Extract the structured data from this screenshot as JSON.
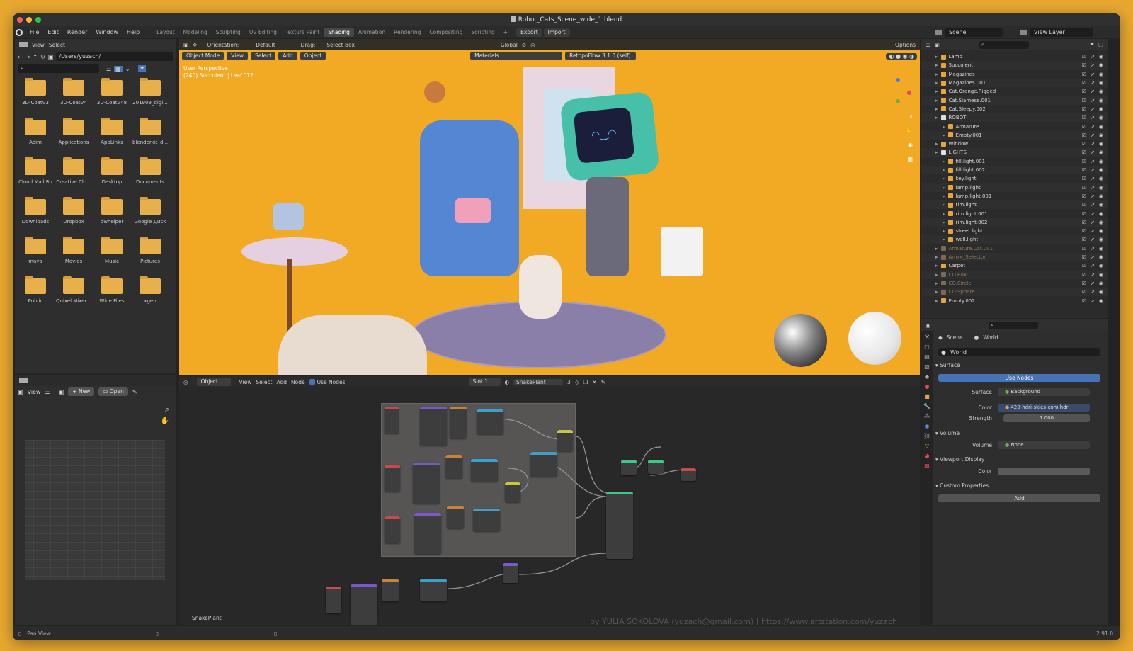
{
  "title": "Robot_Cats_Scene_wide_1.blend",
  "menu": [
    "File",
    "Edit",
    "Render",
    "Window",
    "Help"
  ],
  "workspaces": [
    "Layout",
    "Modeling",
    "Sculpting",
    "UV Editing",
    "Texture Paint",
    "Shading",
    "Animation",
    "Rendering",
    "Compositing",
    "Scripting"
  ],
  "active_workspace": "Shading",
  "export_label": "Export",
  "import_label": "Import",
  "scene_name": "Scene",
  "view_layer": "View Layer",
  "file_browser": {
    "menu": [
      "View",
      "Select"
    ],
    "path": "/Users/yuzach/",
    "folders": [
      "3D-CoatV3",
      "3D-CoatV4",
      "3D-CoatV48",
      "201909_digi...",
      "Adim",
      "Applications",
      "AppLinks",
      "blenderkit_d...",
      "Cloud Mail.Ru",
      "Creative Clo...",
      "Desktop",
      "Documents",
      "Downloads",
      "Dropbox",
      "dwhelper",
      "Google Диск",
      "maya",
      "Movies",
      "Music",
      "Pictures",
      "Public",
      "Quixel Mixer ...",
      "Wine Files",
      "xgen"
    ]
  },
  "viewport": {
    "mode": "Object Mode",
    "menu": [
      "View",
      "Select",
      "Add",
      "Object"
    ],
    "orientation_label": "Orientation:",
    "orientation": "Default",
    "drag_label": "Drag:",
    "drag": "Select Box",
    "transform": "Global",
    "options": "Options",
    "materials": "Materials",
    "retopo": "RetopoFlow 3.1.0 (self)",
    "info1": "User Perspective",
    "info2": "(240) Succulent | Leaf.012"
  },
  "image_editor": {
    "view": "View",
    "new": "New",
    "open": "Open"
  },
  "node_editor": {
    "object": "Object",
    "menu": [
      "View",
      "Select",
      "Add",
      "Node"
    ],
    "use_nodes": "Use Nodes",
    "slot": "Slot 1",
    "material": "SnakePlant",
    "users": "3",
    "frame_label": "SnakePlant",
    "credit": "by YULIA SOKOLOVA (yuzach@gmail.com)  |  https://www.artstation.com/yuzach"
  },
  "outliner": [
    {
      "name": "Lamp",
      "indent": 1,
      "c": "#e8a33c"
    },
    {
      "name": "Succulent",
      "indent": 1,
      "c": "#e8a33c"
    },
    {
      "name": "Magazines",
      "indent": 1,
      "c": "#e8a33c"
    },
    {
      "name": "Magazines.001",
      "indent": 1,
      "c": "#e8a33c"
    },
    {
      "name": "Cat.Orange.Rigged",
      "indent": 1,
      "c": "#e8a33c"
    },
    {
      "name": "Cat.Siamese.001",
      "indent": 1,
      "c": "#e8a33c"
    },
    {
      "name": "Cat.Sleepy.002",
      "indent": 1,
      "c": "#e8a33c"
    },
    {
      "name": "ROBOT",
      "indent": 1,
      "c": "#e0e0e0"
    },
    {
      "name": "Armature",
      "indent": 2,
      "c": "#e8a33c"
    },
    {
      "name": "Empty.001",
      "indent": 2,
      "c": "#e8a33c"
    },
    {
      "name": "Window",
      "indent": 1,
      "c": "#e8a33c"
    },
    {
      "name": "LIGHTS",
      "indent": 1,
      "c": "#e0e0e0"
    },
    {
      "name": "fill.light.001",
      "indent": 2,
      "c": "#e8a33c"
    },
    {
      "name": "fill.light.002",
      "indent": 2,
      "c": "#e8a33c"
    },
    {
      "name": "key.light",
      "indent": 2,
      "c": "#e8a33c"
    },
    {
      "name": "lamp.light",
      "indent": 2,
      "c": "#e8a33c"
    },
    {
      "name": "lamp.light.001",
      "indent": 2,
      "c": "#e8a33c"
    },
    {
      "name": "rim.light",
      "indent": 2,
      "c": "#e8a33c"
    },
    {
      "name": "rim.light.001",
      "indent": 2,
      "c": "#e8a33c"
    },
    {
      "name": "rim.light.002",
      "indent": 2,
      "c": "#e8a33c"
    },
    {
      "name": "street.light",
      "indent": 2,
      "c": "#e8a33c"
    },
    {
      "name": "wall.light",
      "indent": 2,
      "c": "#e8a33c"
    },
    {
      "name": "Armature.Cat.001",
      "indent": 1,
      "c": "#7a6a50"
    },
    {
      "name": "Arrow_Selector",
      "indent": 1,
      "c": "#7a6a50"
    },
    {
      "name": "Carpet",
      "indent": 1,
      "c": "#e8a33c"
    },
    {
      "name": "CO.Box",
      "indent": 1,
      "c": "#7a6a50"
    },
    {
      "name": "CO.Circle",
      "indent": 1,
      "c": "#7a6a50"
    },
    {
      "name": "CO.Sphere",
      "indent": 1,
      "c": "#7a6a50"
    },
    {
      "name": "Empty.002",
      "indent": 1,
      "c": "#e8a33c"
    }
  ],
  "properties": {
    "scene": "Scene",
    "world": "World",
    "world_name": "World",
    "surface_section": "Surface",
    "use_nodes": "Use Nodes",
    "surface_label": "Surface",
    "surface_value": "Background",
    "color_label": "Color",
    "color_value": "420-hdri-skies-com.hdr",
    "strength_label": "Strength",
    "strength_value": "1.000",
    "volume_section": "Volume",
    "volume_label": "Volume",
    "volume_value": "None",
    "viewport_section": "Viewport Display",
    "vcolor_label": "Color",
    "custom_section": "Custom Properties",
    "add": "Add"
  },
  "status": {
    "pan": "Pan View",
    "version": "2.91.0"
  }
}
